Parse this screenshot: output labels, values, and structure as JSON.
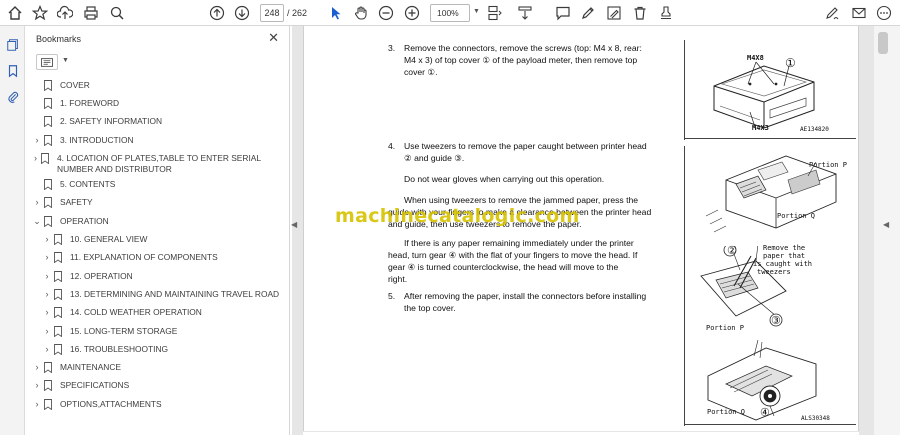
{
  "toolbar": {
    "current_page": "248",
    "page_total": "/ 262",
    "zoom": "100%"
  },
  "bookmarks": {
    "title": "Bookmarks",
    "close": "✕",
    "items": [
      {
        "label": "COVER",
        "expandable": false,
        "expanded": false,
        "indent": 0
      },
      {
        "label": "1. FOREWORD",
        "expandable": false,
        "expanded": false,
        "indent": 0
      },
      {
        "label": "2. SAFETY INFORMATION",
        "expandable": false,
        "expanded": false,
        "indent": 0
      },
      {
        "label": "3. INTRODUCTION",
        "expandable": true,
        "expanded": false,
        "indent": 0
      },
      {
        "label": "4. LOCATION OF PLATES,TABLE TO ENTER SERIAL NUMBER AND DISTRIBUTOR",
        "expandable": true,
        "expanded": false,
        "indent": 0
      },
      {
        "label": "5. CONTENTS",
        "expandable": false,
        "expanded": false,
        "indent": 0
      },
      {
        "label": "SAFETY",
        "expandable": true,
        "expanded": false,
        "indent": 0
      },
      {
        "label": "OPERATION",
        "expandable": true,
        "expanded": true,
        "indent": 0
      },
      {
        "label": "10. GENERAL VIEW",
        "expandable": true,
        "expanded": false,
        "indent": 1
      },
      {
        "label": "11. EXPLANATION OF COMPONENTS",
        "expandable": true,
        "expanded": false,
        "indent": 1
      },
      {
        "label": "12. OPERATION",
        "expandable": true,
        "expanded": false,
        "indent": 1
      },
      {
        "label": "13. DETERMINING AND MAINTAINING TRAVEL ROAD",
        "expandable": true,
        "expanded": false,
        "indent": 1
      },
      {
        "label": "14. COLD WEATHER OPERATION",
        "expandable": true,
        "expanded": false,
        "indent": 1
      },
      {
        "label": "15. LONG-TERM STORAGE",
        "expandable": true,
        "expanded": false,
        "indent": 1
      },
      {
        "label": "16. TROUBLESHOOTING",
        "expandable": true,
        "expanded": false,
        "indent": 1
      },
      {
        "label": "MAINTENANCE",
        "expandable": true,
        "expanded": false,
        "indent": 0
      },
      {
        "label": "SPECIFICATIONS",
        "expandable": true,
        "expanded": false,
        "indent": 0
      },
      {
        "label": "OPTIONS,ATTACHMENTS",
        "expandable": true,
        "expanded": false,
        "indent": 0
      }
    ]
  },
  "document": {
    "step3_num": "3.",
    "step3_l1": "Remove the connectors, remove the screws (top: M4 x 8, rear:",
    "step3_l2": "M4 x 3) of top cover ① of the payload meter, then remove top",
    "step3_l3": "cover ①.",
    "step4_num": "4.",
    "step4_l1": "Use tweezers to remove the paper caught between printer head",
    "step4_l2": "② and guide ③.",
    "note1": "Do not wear gloves when carrying out this operation.",
    "para2_l1": "When using tweezers to remove the jammed paper, press the",
    "para2_l2": "guide with your fingers to make a clearance between the printer head",
    "para2_l3": "and guide, then use tweezers to remove the paper.",
    "para3_l1": "If there is any paper remaining immediately under the printer",
    "para3_l2": "head, turn gear ④ with the flat of your fingers to move the head. If",
    "para3_l3": "gear ④ is turned counterclockwise, the head will move to the",
    "para3_l4": "right.",
    "step5_num": "5.",
    "step5_l1": "After removing the paper, install the connectors before installing",
    "step5_l2": "the top cover.",
    "fig1_m4x8": "M4X8",
    "fig1_m4x3": "M4X3",
    "fig1_num": "①",
    "fig1_code": "AE134820",
    "fig2_portion_p": "Portion P",
    "fig2_portion_q": "Portion Q",
    "fig3_note_l1": "Remove the",
    "fig3_note_l2": "paper that",
    "fig3_note_l3": "is caught with",
    "fig3_note_l4": "tweezers",
    "fig3_portion_p": "Portion P",
    "fig3_num2": "②",
    "fig3_num3": "③",
    "fig4_portion_q": "Portion Q",
    "fig4_num4": "④",
    "fig4_code": "ALS30348"
  },
  "watermark": "machinecatalogic.com"
}
